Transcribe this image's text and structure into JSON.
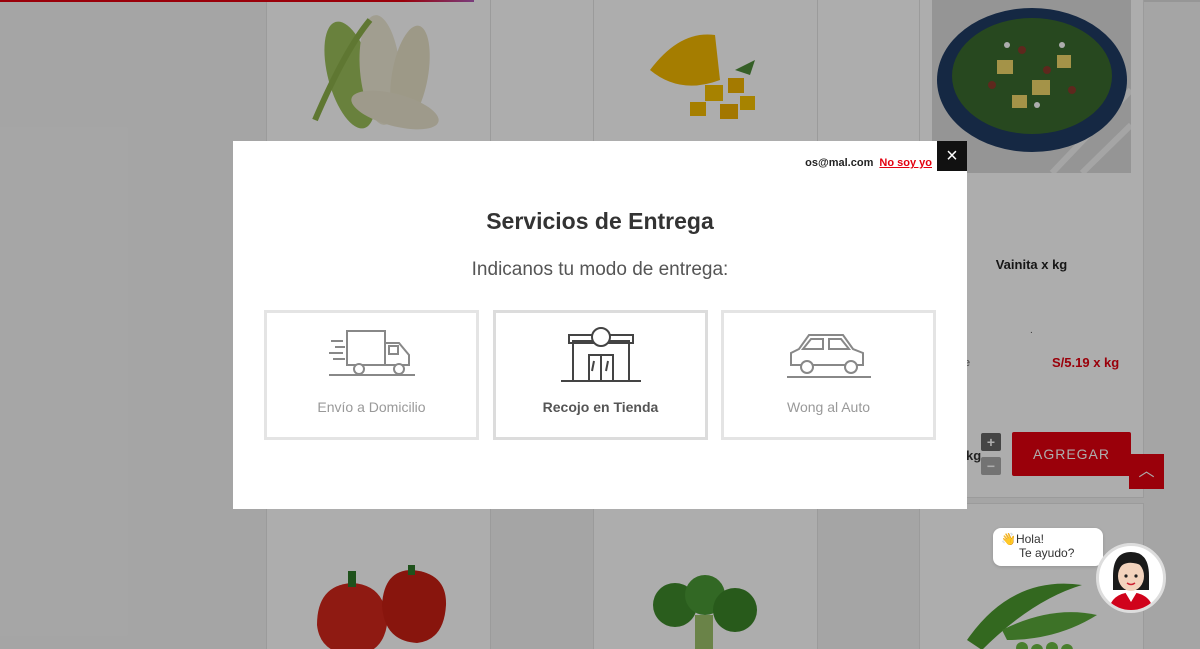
{
  "product": {
    "name": "Vainita x kg",
    "dot": ".",
    "unit_partial": "e",
    "price": "S/5.19 x kg",
    "qty_unit": "kg",
    "plus": "+",
    "minus": "−",
    "add_label": "AGREGAR",
    "scroll_top": "︿"
  },
  "modal": {
    "user_email": "os@mal.com",
    "not_me": "No soy yo",
    "close": "×",
    "title": "Servicios de Entrega",
    "subtitle": "Indicanos tu modo de entrega:",
    "options": [
      {
        "label": "Envío a Domicilio",
        "icon": "delivery-truck-icon"
      },
      {
        "label": "Recojo en Tienda",
        "icon": "store-pickup-icon"
      },
      {
        "label": "Wong al Auto",
        "icon": "car-icon"
      }
    ]
  },
  "chat": {
    "emoji": "👋",
    "line1": "Hola!",
    "line2": "Te ayudo?"
  },
  "colors": {
    "brand_red": "#e3000f"
  }
}
